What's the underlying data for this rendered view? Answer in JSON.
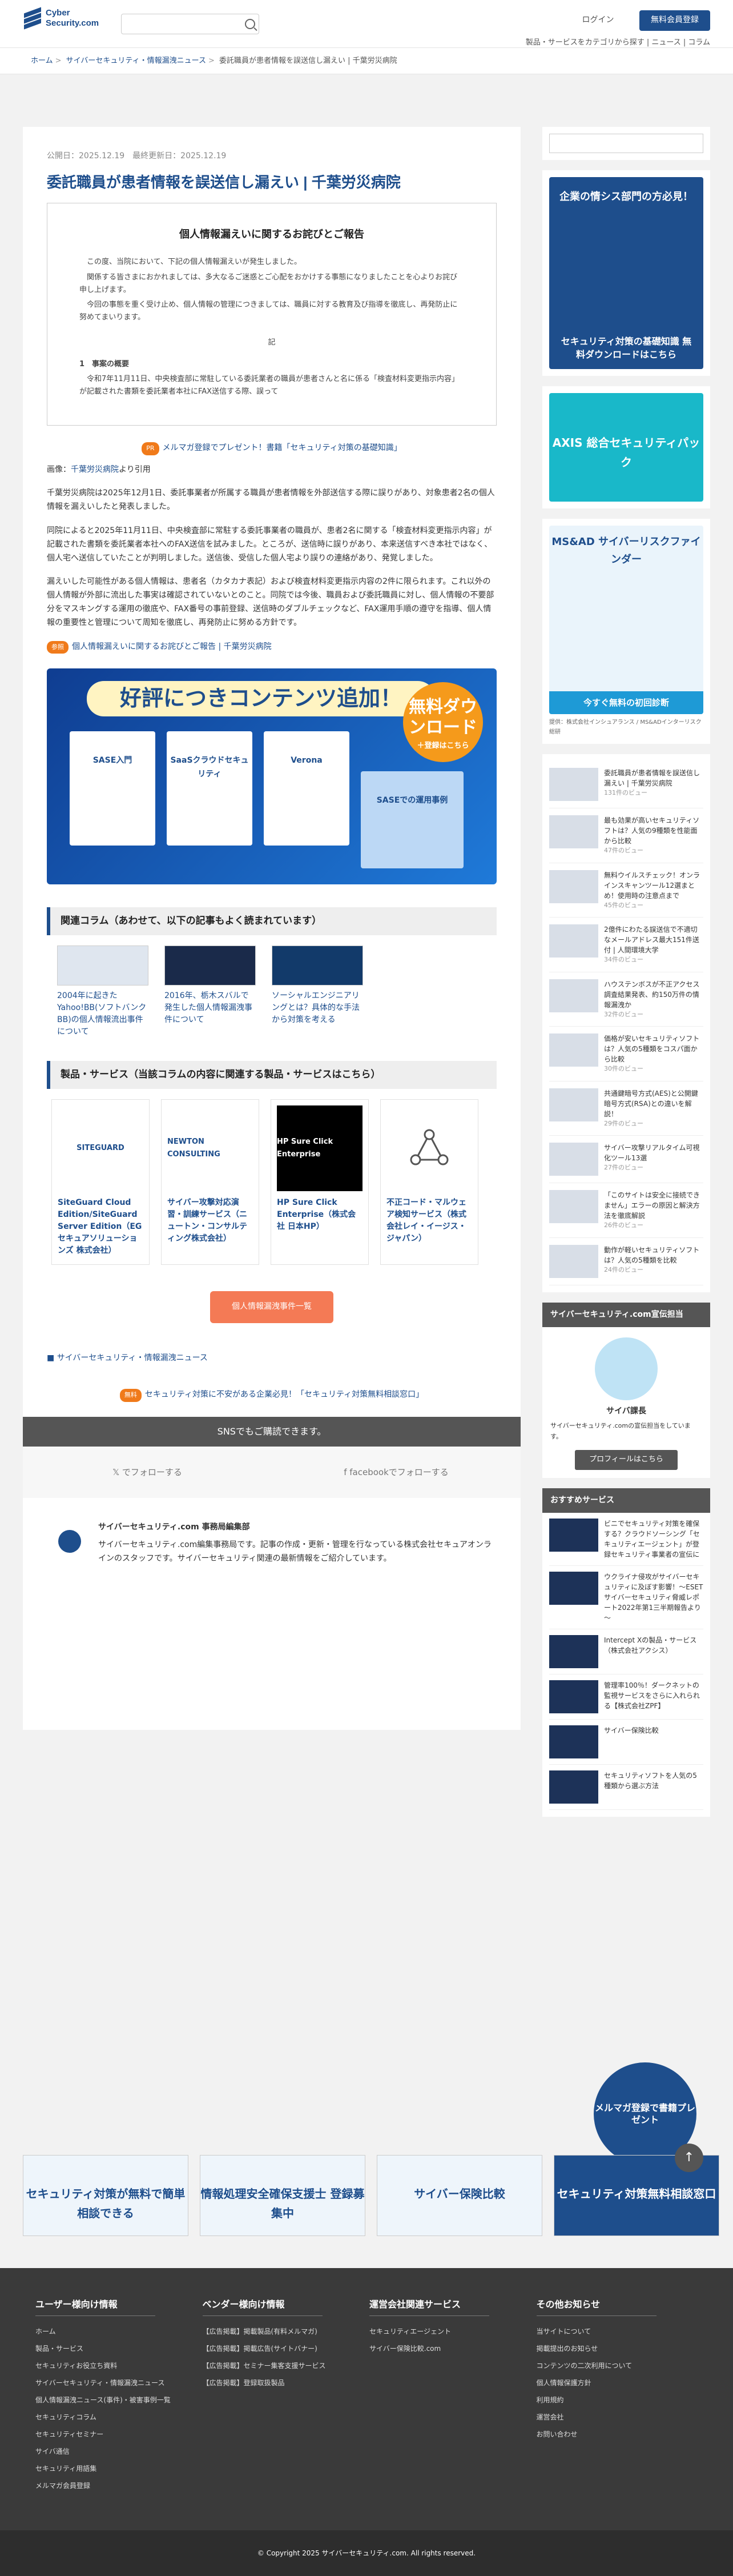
{
  "header": {
    "logo_line1": "Cyber",
    "logo_line2": "Security.com",
    "login": "ログイン",
    "cta": "無料会員登録",
    "links": "製品・サービスをカテゴリから探す | ニュース | コラム"
  },
  "breadcrumb": [
    "ホーム",
    "サイバーセキュリティ・情報漏洩ニュース",
    "委託職員が患者情報を誤送信し漏えい | 千葉労災病院"
  ],
  "article": {
    "published": "公開日：2025.12.19",
    "updated": "最終更新日：2025.12.19",
    "title": "委託職員が患者情報を誤送信し漏えい | 千葉労災病院",
    "notice_title": "個人情報漏えいに関するお詫びとご報告",
    "notice_p1": "この度、当院において、下記の個人情報漏えいが発生しました。",
    "notice_p2": "関係する皆さまにおかれましては、多大なるご迷惑とご心配をおかけする事態になりましたことを心よりお詫び申し上げます。",
    "notice_p3": "今回の事態を重く受け止め、個人情報の管理につきましては、職員に対する教育及び指導を徹底し、再発防止に努めてまいります。",
    "notice_ki": "記",
    "notice_h": "1　事案の概要",
    "notice_p4": "令和7年11月11日、中央検査部に常駐している委託業者の職員が患者さんと名に係る「検査材料変更指示内容」が記載された書類を委託業者本社にFAX送信する際、誤って",
    "promo_tag": "PR",
    "promo": "メルマガ登録でプレゼント！書籍「セキュリティ対策の基礎知識」",
    "source_prefix": "画像：",
    "source_link": "千葉労災病院",
    "source_suffix": "より引用",
    "p1": "千葉労災病院は2025年12月1日、委託事業者が所属する職員が患者情報を外部送信する際に誤りがあり、対象患者2名の個人情報を漏えいしたと発表しました。",
    "p2": "同院によると2025年11月11日、中央検査部に常駐する委託事業者の職員が、患者2名に関する「検査材料変更指示内容」が記載された書類を委託業者本社へのFAX送信を試みました。ところが、送信時に誤りがあり、本来送信すべき本社ではなく、個人宅へ送信していたことが判明しました。送信後、受信した個人宅より誤りの連絡があり、発覚しました。",
    "p3": "漏えいした可能性がある個人情報は、患者名（カタカナ表記）および検査材料変更指示内容の2件に限られます。これ以外の個人情報が外部に流出した事実は確認されていないとのこと。同院では今後、職員および委託職員に対し、個人情報の不要部分をマスキングする運用の徹底や、FAX番号の事前登録、送信時のダブルチェックなど、FAX運用手順の遵守を指導、個人情報の重要性と管理について周知を徹底し、再発防止に努める方針です。",
    "ref_tag": "参照",
    "ref_link": "個人情報漏えいに関するお詫びとご報告 | 千葉労災病院"
  },
  "banner": {
    "headline": "好評につきコンテンツ追加！",
    "circle_main": "無料ダウンロード",
    "circle_sub": "＋登録はこちら",
    "book1": "SASE入門",
    "book2": "SaaSクラウドセキュリティ",
    "book3": "Verona",
    "book4": "SASEでの運用事例"
  },
  "related": {
    "heading": "関連コラム（あわせて、以下の記事もよく読まれています）",
    "items": [
      "2004年に起きたYahoo!BB(ソフトバンクBB)の個人情報流出事件について",
      "2016年、栃木スバルで発生した個人情報漏洩事件について",
      "ソーシャルエンジニアリングとは？具体的な手法から対策を考える"
    ]
  },
  "products": {
    "heading": "製品・サービス（当該コラムの内容に関連する製品・サービスはこちら）",
    "items": [
      {
        "name": "SiteGuard Cloud Edition/SiteGuard Server Edition（EG セキュアソリューションズ 株式会社）",
        "logo": "SITEGUARD"
      },
      {
        "name": "サイバー攻撃対応演習・訓練サービス（ニュートン・コンサルティング株式会社）",
        "logo": "NEWTON CONSULTING"
      },
      {
        "name": "HP Sure Click Enterprise（株式会社 日本HP）",
        "logo": "HP Sure Click Enterprise"
      },
      {
        "name": "不正コード・マルウェア検知サービス（株式会社レイ・イージス・ジャパン）",
        "logo": "network-icon"
      }
    ]
  },
  "list_button": "個人情報漏洩事件一覧",
  "category": "サイバーセキュリティ・情報漏洩ニュース",
  "free_tag": "無料",
  "free_text": "セキュリティ対策に不安がある企業必見！「セキュリティ対策無料相談窓口」",
  "sns": {
    "heading": "SNSでもご購読できます。",
    "x": "でフォローする",
    "facebook": "facebookでフォローする"
  },
  "author": {
    "name": "サイバーセキュリティ.com 事務局編集部",
    "text": "サイバーセキュリティ.com編集事務局です。記事の作成・更新・管理を行なっている株式会社セキュアオンラインのスタッフです。サイバーセキュリティ関連の最新情報をご紹介しています。"
  },
  "sidebar": {
    "ad1": "企業の情シス部門の方必見！",
    "ad1_sub": "セキュリティ対策の基礎知識 無料ダウンロードはこちら",
    "ad2": "AXIS 総合セキュリティパック",
    "ad3": "MS&AD サイバーリスクファインダー",
    "ad3_sub": "今すぐ無料の初回診断",
    "ad3_meta": "提供：株式会社インシュアランス / MS&ADインターリスク総研",
    "latest": [
      {
        "title": "委託職員が患者情報を誤送信し漏えい | 千葉労災病院",
        "meta": "131件のビュー"
      },
      {
        "title": "最も効果が高いセキュリティソフトは？人気の9種類を性能面から比較",
        "meta": "47件のビュー"
      },
      {
        "title": "無料ウイルスチェック！オンラインスキャンツール12選まとめ！使用時の注意点まで",
        "meta": "45件のビュー"
      },
      {
        "title": "2億件にわたる誤送信で不適切なメールアドレス最大151件送付 | 人間環境大学",
        "meta": "34件のビュー"
      },
      {
        "title": "ハウステンボスが不正アクセス調査結果発表、約150万件の情報漏洩か",
        "meta": "32件のビュー"
      },
      {
        "title": "価格が安いセキュリティソフトは？人気の5種類をコスパ面から比較",
        "meta": "30件のビュー"
      },
      {
        "title": "共通鍵暗号方式(AES)と公開鍵暗号方式(RSA)との違いを解説！",
        "meta": "29件のビュー"
      },
      {
        "title": "サイバー攻撃リアルタイム可視化ツール13選",
        "meta": "27件のビュー"
      },
      {
        "title": "「このサイトは安全に接続できません」エラーの原因と解決方法を徹底解説",
        "meta": "26件のビュー"
      },
      {
        "title": "動作が軽いセキュリティソフトは？人気の5種類を比較",
        "meta": "24件のビュー"
      }
    ],
    "ambassador_title": "サイバーセキュリティ.com宣伝担当",
    "ambassador_name": "サイバ課長",
    "ambassador_text": "サイバーセキュリティ.comの宣伝担当をしています。",
    "profile_button": "プロフィールはこちら",
    "recommend_title": "おすすめサービス",
    "recommend": [
      "ビニでセキュリティ対策を確保する？クラウドソーシング「セキュリティエージェント」が登録セキュリティ事業者の宣伝に",
      "ウクライナ侵攻がサイバーセキュリティに及ぼす影響！～ESETサイバーセキュリティ脅威レポート2022年第1三半期報告より～",
      "Intercept Xの製品・サービス（株式会社アクシス）",
      "管理率100％！ダークネットの監視サービスをさらに入れられる【株式会社ZPF】",
      "サイバー保険比較",
      "セキュリティソフトを人気の5種類から選ぶ方法"
    ],
    "float_cta": "メルマガ登録で書籍プレゼント"
  },
  "bottom_ads": [
    "セキュリティ対策が無料で簡単相談できる",
    "情報処理安全確保支援士 登録募集中",
    "サイバー保険比較",
    "セキュリティ対策無料相談窓口"
  ],
  "footer": {
    "cols": [
      {
        "title": "ユーザー様向け情報",
        "items": [
          "ホーム",
          "製品・サービス",
          "セキュリティお役立ち資料",
          "サイバーセキュリティ・情報漏洩ニュース",
          "個人情報漏洩ニュース(事件)・被害事例一覧",
          "セキュリティコラム",
          "セキュリティセミナー",
          "サイバ通信",
          "セキュリティ用語集",
          "メルマガ会員登録"
        ]
      },
      {
        "title": "ベンダー様向け情報",
        "items": [
          "【広告掲載】掲載製品(有料メルマガ)",
          "【広告掲載】掲載広告(サイトバナー)",
          "【広告掲載】セミナー集客支援サービス",
          "【広告掲載】登録取扱製品"
        ]
      },
      {
        "title": "運営会社関連サービス",
        "items": [
          "セキュリティエージェント",
          "サイバー保険比較.com"
        ]
      },
      {
        "title": "その他お知らせ",
        "items": [
          "当サイトについて",
          "掲載提出のお知らせ",
          "コンテンツの二次利用について",
          "個人情報保護方針",
          "利用規約",
          "運営会社",
          "お問い合わせ"
        ]
      }
    ],
    "copyright": "© Copyright 2025 サイバーセキュリティ.com. All rights reserved."
  },
  "colors": {
    "brand": "#1e4e8c",
    "accent": "#f47a55",
    "footer": "#3a3a3a"
  }
}
